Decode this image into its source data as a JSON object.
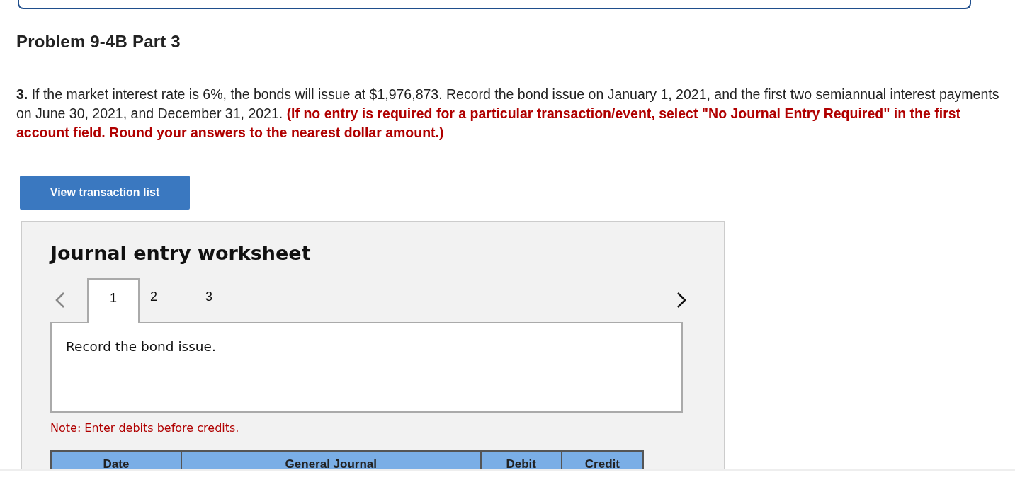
{
  "heading": "Problem 9-4B Part 3",
  "instructions": "**3.** If the market interest rate is 6%, the bonds will issue at $1,976,873. Record the bond issue on January 1, 2021, and the first two semiannual interest payments on June 30, 2021, and December 31, 2021. **(If no entry is required for a particular transaction/event, select \"No Journal Entry Required\" in the first account field. Round your answers to the nearest dollar amount.)**",
  "view_button": "View transaction list",
  "worksheet": {
    "title": "Journal entry worksheet",
    "tabs": [
      {
        "label": "1",
        "selected": true
      },
      {
        "label": "2",
        "selected": false
      },
      {
        "label": "3",
        "selected": false
      }
    ],
    "prompt": "Record the bond issue.",
    "note": "Note: Enter debits before credits.",
    "columns": [
      "Date",
      "General Journal",
      "Debit",
      "Credit"
    ]
  }
}
